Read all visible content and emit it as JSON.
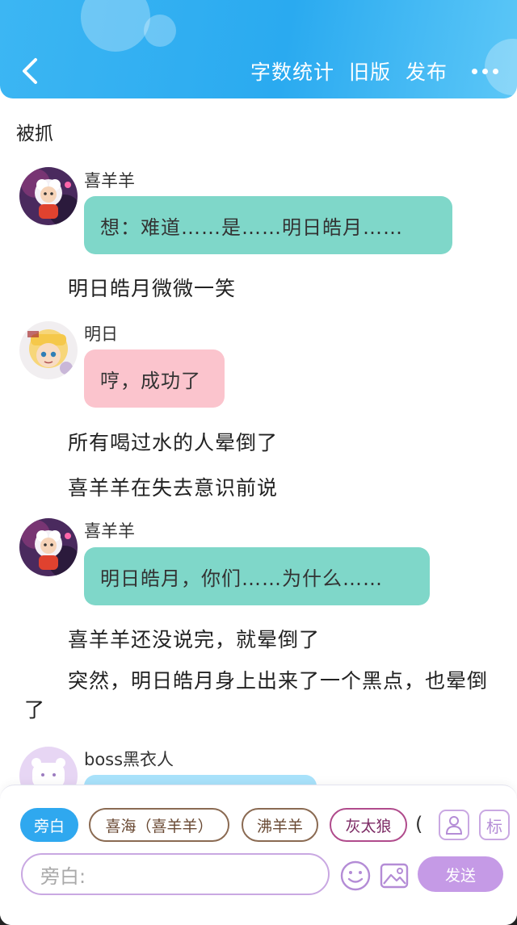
{
  "header": {
    "word_count": "字数统计",
    "old_version": "旧版",
    "publish": "发布"
  },
  "story": {
    "title": "被抓",
    "speaker1": "喜羊羊",
    "msg1": "想：难道……是……明日皓月……",
    "narr1": "明日皓月微微一笑",
    "speaker2": "明日",
    "msg2": "哼，成功了",
    "narr2": "所有喝过水的人晕倒了",
    "narr3": "喜羊羊在失去意识前说",
    "speaker3": "喜羊羊",
    "msg3": "明日皓月，你们……为什么……",
    "narr4": "喜羊羊还没说完，就晕倒了",
    "narr5": "突然，明日皓月身上出来了一个黑点，也晕倒了",
    "speaker4": "boss黑衣人"
  },
  "composer": {
    "chips": [
      "旁白",
      "喜海（喜羊羊）",
      "沸羊羊",
      "灰太狼"
    ],
    "partial": "(",
    "mark_label": "标",
    "input_placeholder": "旁白:",
    "send": "发送"
  },
  "colors": {
    "header": "#2aaaf0",
    "teal_bubble": "#7fd7c9",
    "pink_bubble": "#fbc4cd",
    "blue_bubble": "#a9e2fb",
    "send": "#c59ae6"
  }
}
